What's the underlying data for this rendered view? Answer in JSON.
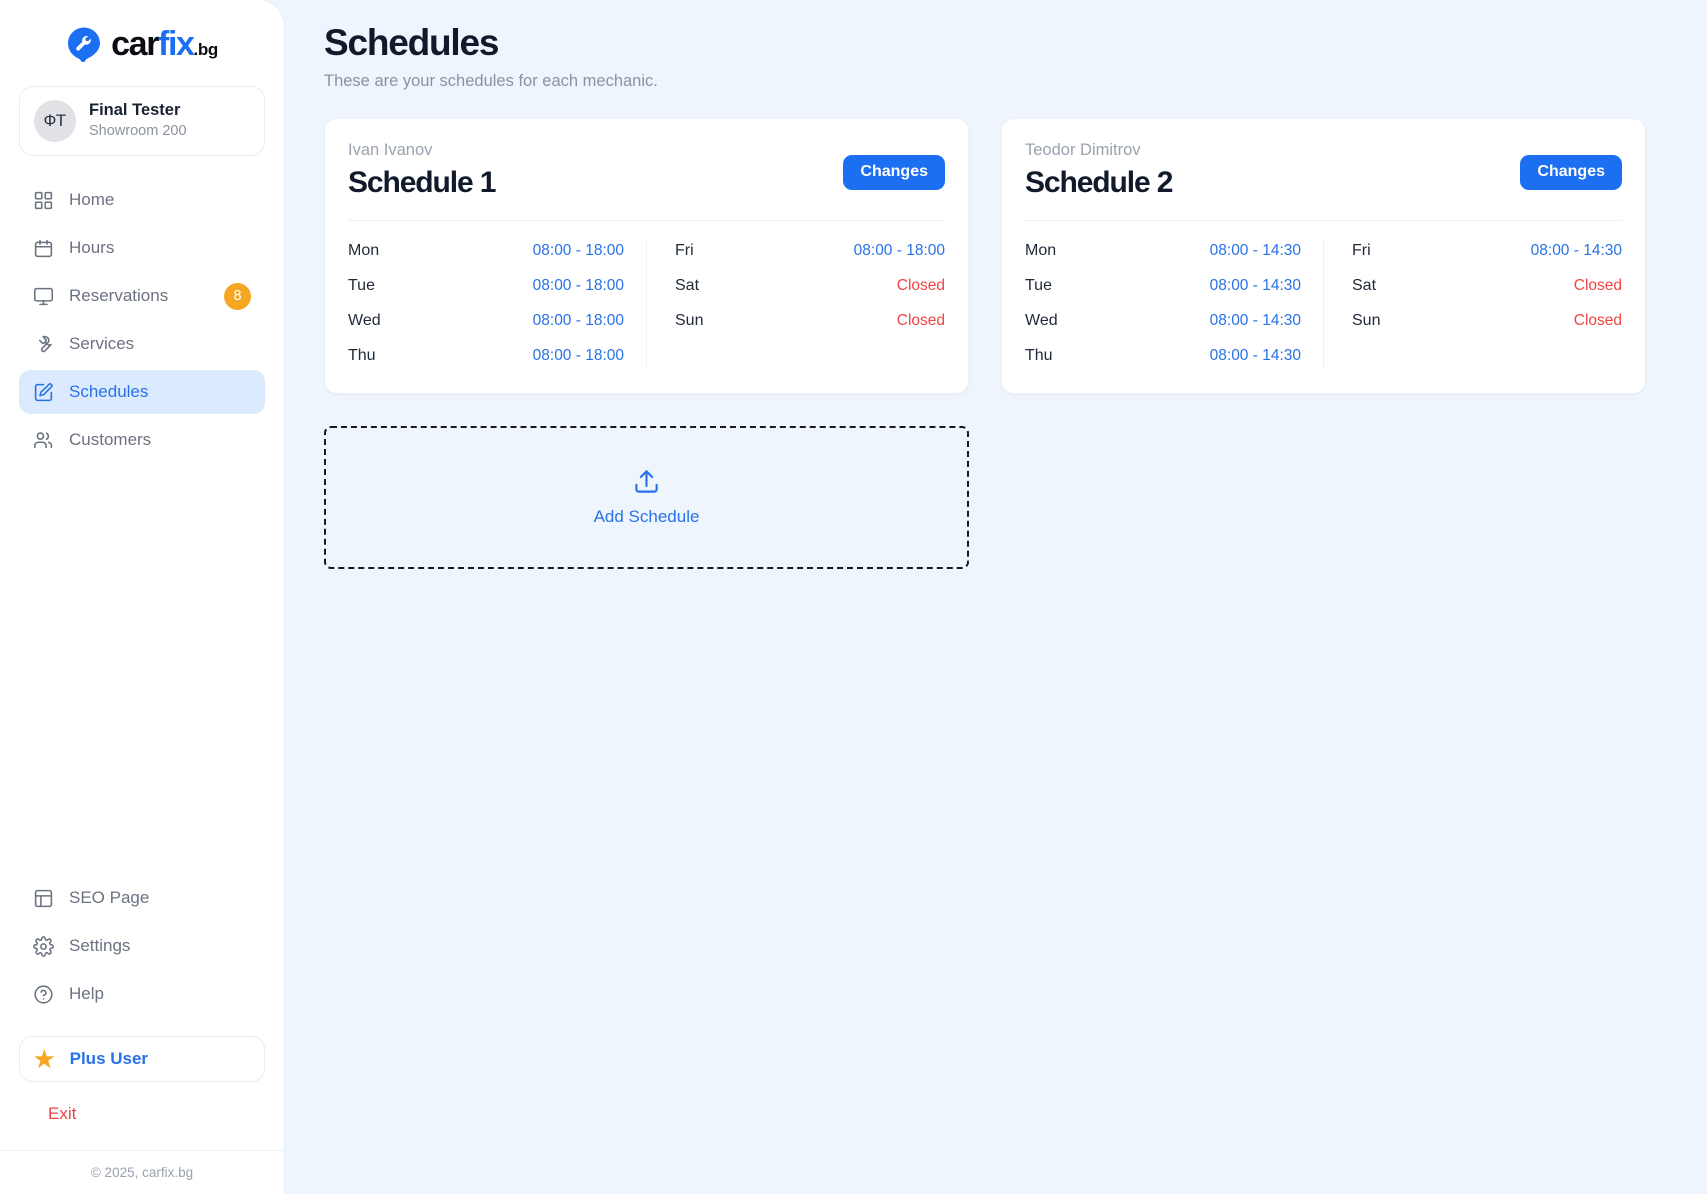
{
  "brand": {
    "logo_icon": "wrench-pin-icon",
    "name_part1": "car",
    "name_part2": "fix",
    "name_tld": ".bg",
    "accent_blue": "#1d6ff2",
    "dark": "#0b0d12"
  },
  "user": {
    "initials": "ФТ",
    "name": "Final Tester",
    "subtitle": "Showroom 200"
  },
  "sidebar": {
    "items": [
      {
        "label": "Home",
        "icon": "grid-icon",
        "active": false,
        "badge": null
      },
      {
        "label": "Hours",
        "icon": "calendar-icon",
        "active": false,
        "badge": null
      },
      {
        "label": "Reservations",
        "icon": "monitor-icon",
        "active": false,
        "badge": "8"
      },
      {
        "label": "Services",
        "icon": "wrench-icon",
        "active": false,
        "badge": null
      },
      {
        "label": "Schedules",
        "icon": "square-pen-icon",
        "active": true,
        "badge": null
      },
      {
        "label": "Customers",
        "icon": "users-icon",
        "active": false,
        "badge": null
      }
    ],
    "bottom_items": [
      {
        "label": "SEO Page",
        "icon": "panel-layout-icon"
      },
      {
        "label": "Settings",
        "icon": "gear-icon"
      },
      {
        "label": "Help",
        "icon": "question-circle-icon"
      }
    ],
    "plus_user": {
      "label": "Plus User",
      "icon": "star-icon",
      "color": "#2872e8",
      "star_color": "#f5a623"
    },
    "exit": {
      "label": "Exit",
      "icon": "log-out-icon",
      "color": "#ef4444"
    },
    "footer": "© 2025, carfix.bg",
    "badge_color": "#f5a623",
    "active_bg": "#dbeafe"
  },
  "header": {
    "title": "Schedules",
    "subtitle": "These are your schedules for each mechanic."
  },
  "cards": [
    {
      "mechanic": "Ivan Ivanov",
      "title": "Schedule 1",
      "button": "Changes",
      "left_days": [
        {
          "day": "Mon",
          "hours": "08:00 - 18:00",
          "closed": false
        },
        {
          "day": "Tue",
          "hours": "08:00 - 18:00",
          "closed": false
        },
        {
          "day": "Wed",
          "hours": "08:00 - 18:00",
          "closed": false
        },
        {
          "day": "Thu",
          "hours": "08:00 - 18:00",
          "closed": false
        }
      ],
      "right_days": [
        {
          "day": "Fri",
          "hours": "08:00 - 18:00",
          "closed": false
        },
        {
          "day": "Sat",
          "hours": "Closed",
          "closed": true
        },
        {
          "day": "Sun",
          "hours": "Closed",
          "closed": true
        }
      ]
    },
    {
      "mechanic": "Teodor Dimitrov",
      "title": "Schedule 2",
      "button": "Changes",
      "left_days": [
        {
          "day": "Mon",
          "hours": "08:00 - 14:30",
          "closed": false
        },
        {
          "day": "Tue",
          "hours": "08:00 - 14:30",
          "closed": false
        },
        {
          "day": "Wed",
          "hours": "08:00 - 14:30",
          "closed": false
        },
        {
          "day": "Thu",
          "hours": "08:00 - 14:30",
          "closed": false
        }
      ],
      "right_days": [
        {
          "day": "Fri",
          "hours": "08:00 - 14:30",
          "closed": false
        },
        {
          "day": "Sat",
          "hours": "Closed",
          "closed": true
        },
        {
          "day": "Sun",
          "hours": "Closed",
          "closed": true
        }
      ]
    }
  ],
  "add_schedule": {
    "label": "Add Schedule",
    "icon": "upload-icon"
  }
}
